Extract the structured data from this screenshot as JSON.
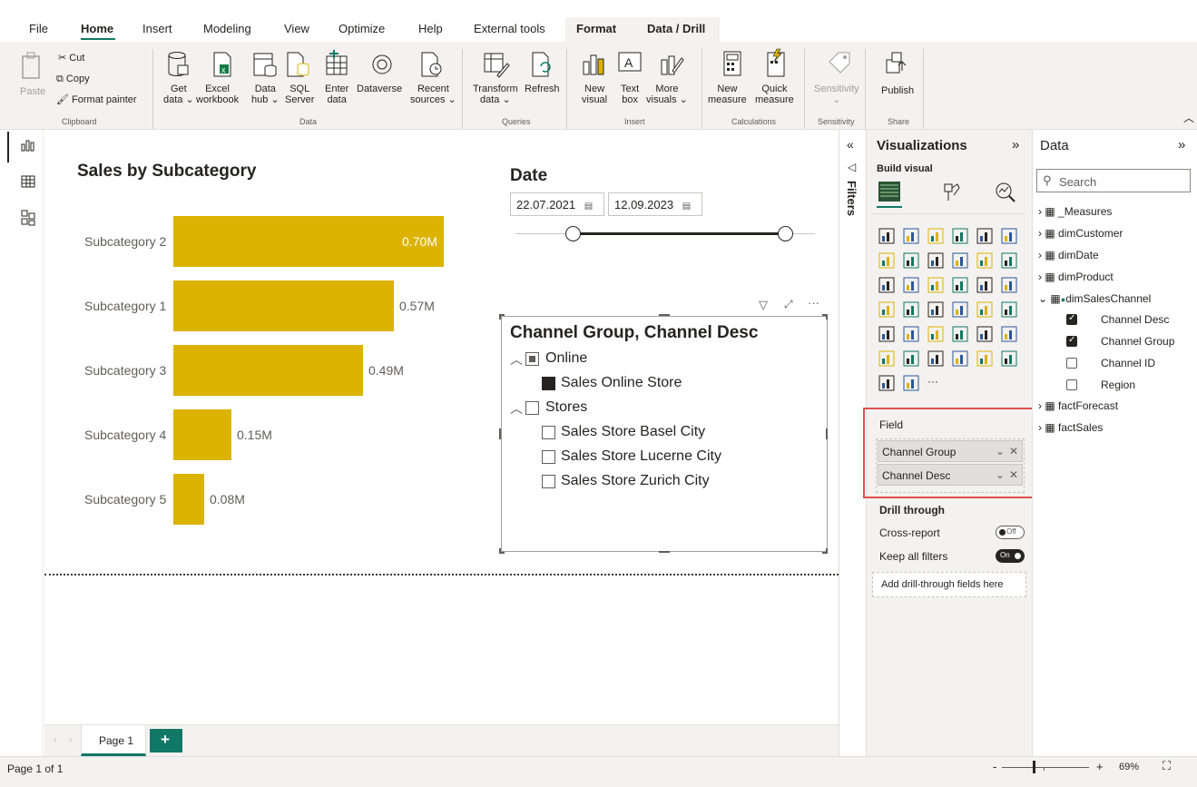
{
  "menu": {
    "file": "File",
    "home": "Home",
    "insert": "Insert",
    "modeling": "Modeling",
    "view": "View",
    "optimize": "Optimize",
    "help": "Help",
    "external_tools": "External tools",
    "format": "Format",
    "data_drill": "Data / Drill"
  },
  "ribbon": {
    "clipboard": {
      "paste": "Paste",
      "cut": "Cut",
      "copy": "Copy",
      "format_painter": "Format painter",
      "group": "Clipboard"
    },
    "data": {
      "get_data": [
        "Get",
        "data ⌄"
      ],
      "excel": [
        "Excel",
        "workbook"
      ],
      "data_hub": [
        "Data",
        "hub ⌄"
      ],
      "sql": [
        "SQL",
        "Server"
      ],
      "enter": [
        "Enter",
        "data"
      ],
      "dataverse": "Dataverse",
      "recent": [
        "Recent",
        "sources ⌄"
      ],
      "group": "Data"
    },
    "queries": {
      "transform": [
        "Transform",
        "data ⌄"
      ],
      "refresh": "Refresh",
      "group": "Queries"
    },
    "insert": {
      "new_visual": [
        "New",
        "visual"
      ],
      "text_box": [
        "Text",
        "box"
      ],
      "more_visuals": [
        "More",
        "visuals ⌄"
      ],
      "group": "Insert"
    },
    "calculations": {
      "new_measure": [
        "New",
        "measure"
      ],
      "quick_measure": [
        "Quick",
        "measure"
      ],
      "group": "Calculations"
    },
    "sensitivity": {
      "label": [
        "Sensitivity",
        "⌄"
      ],
      "group": "Sensitivity"
    },
    "share": {
      "publish": "Publish",
      "group": "Share"
    }
  },
  "chart": {
    "title": "Sales by Subcategory",
    "chart_data": {
      "type": "bar",
      "orientation": "horizontal",
      "title": "Sales by Subcategory",
      "categories": [
        "Subcategory 2",
        "Subcategory 1",
        "Subcategory 3",
        "Subcategory 4",
        "Subcategory 5"
      ],
      "values": [
        0.7,
        0.57,
        0.49,
        0.15,
        0.08
      ],
      "labels": [
        "0.70M",
        "0.57M",
        "0.49M",
        "0.15M",
        "0.08M"
      ],
      "unit": "M",
      "color": "#dbb300"
    }
  },
  "date_slicer": {
    "title": "Date",
    "start": "22.07.2021",
    "end": "12.09.2023"
  },
  "hierarchy_slicer": {
    "title": "Channel Group, Channel Desc",
    "groups": [
      {
        "label": "Online",
        "state": "partial",
        "items": [
          {
            "label": "Sales Online Store",
            "checked": true
          }
        ]
      },
      {
        "label": "Stores",
        "state": "none",
        "items": [
          {
            "label": "Sales Store Basel City",
            "checked": false
          },
          {
            "label": "Sales Store Lucerne City",
            "checked": false
          },
          {
            "label": "Sales Store Zurich City",
            "checked": false
          }
        ]
      }
    ]
  },
  "filters": {
    "label": "Filters"
  },
  "visualizations": {
    "title": "Visualizations",
    "build_visual": "Build visual",
    "field_label": "Field",
    "fields": [
      "Channel Group",
      "Channel Desc"
    ],
    "drill_through": "Drill through",
    "cross_report": "Cross-report",
    "cross_report_state": "Off",
    "keep_all_filters": "Keep all filters",
    "keep_all_filters_state": "On",
    "add_drill": "Add drill-through fields here",
    "more": "···"
  },
  "data_pane": {
    "title": "Data",
    "search_placeholder": "Search",
    "tables": [
      "_Measures",
      "dimCustomer",
      "dimDate",
      "dimProduct",
      "dimSalesChannel",
      "factForecast",
      "factSales"
    ],
    "sales_channel_fields": [
      {
        "name": "Channel Desc",
        "checked": true
      },
      {
        "name": "Channel Group",
        "checked": true
      },
      {
        "name": "Channel ID",
        "checked": false
      },
      {
        "name": "Region",
        "checked": false
      }
    ]
  },
  "pages": {
    "tab": "Page 1",
    "add": "+"
  },
  "status": {
    "page": "Page 1 of 1",
    "zoom": "69%",
    "zoom_level": 0.69
  },
  "colors": {
    "accent": "#117865",
    "bar": "#dbb300",
    "highlight": "#d13438"
  }
}
